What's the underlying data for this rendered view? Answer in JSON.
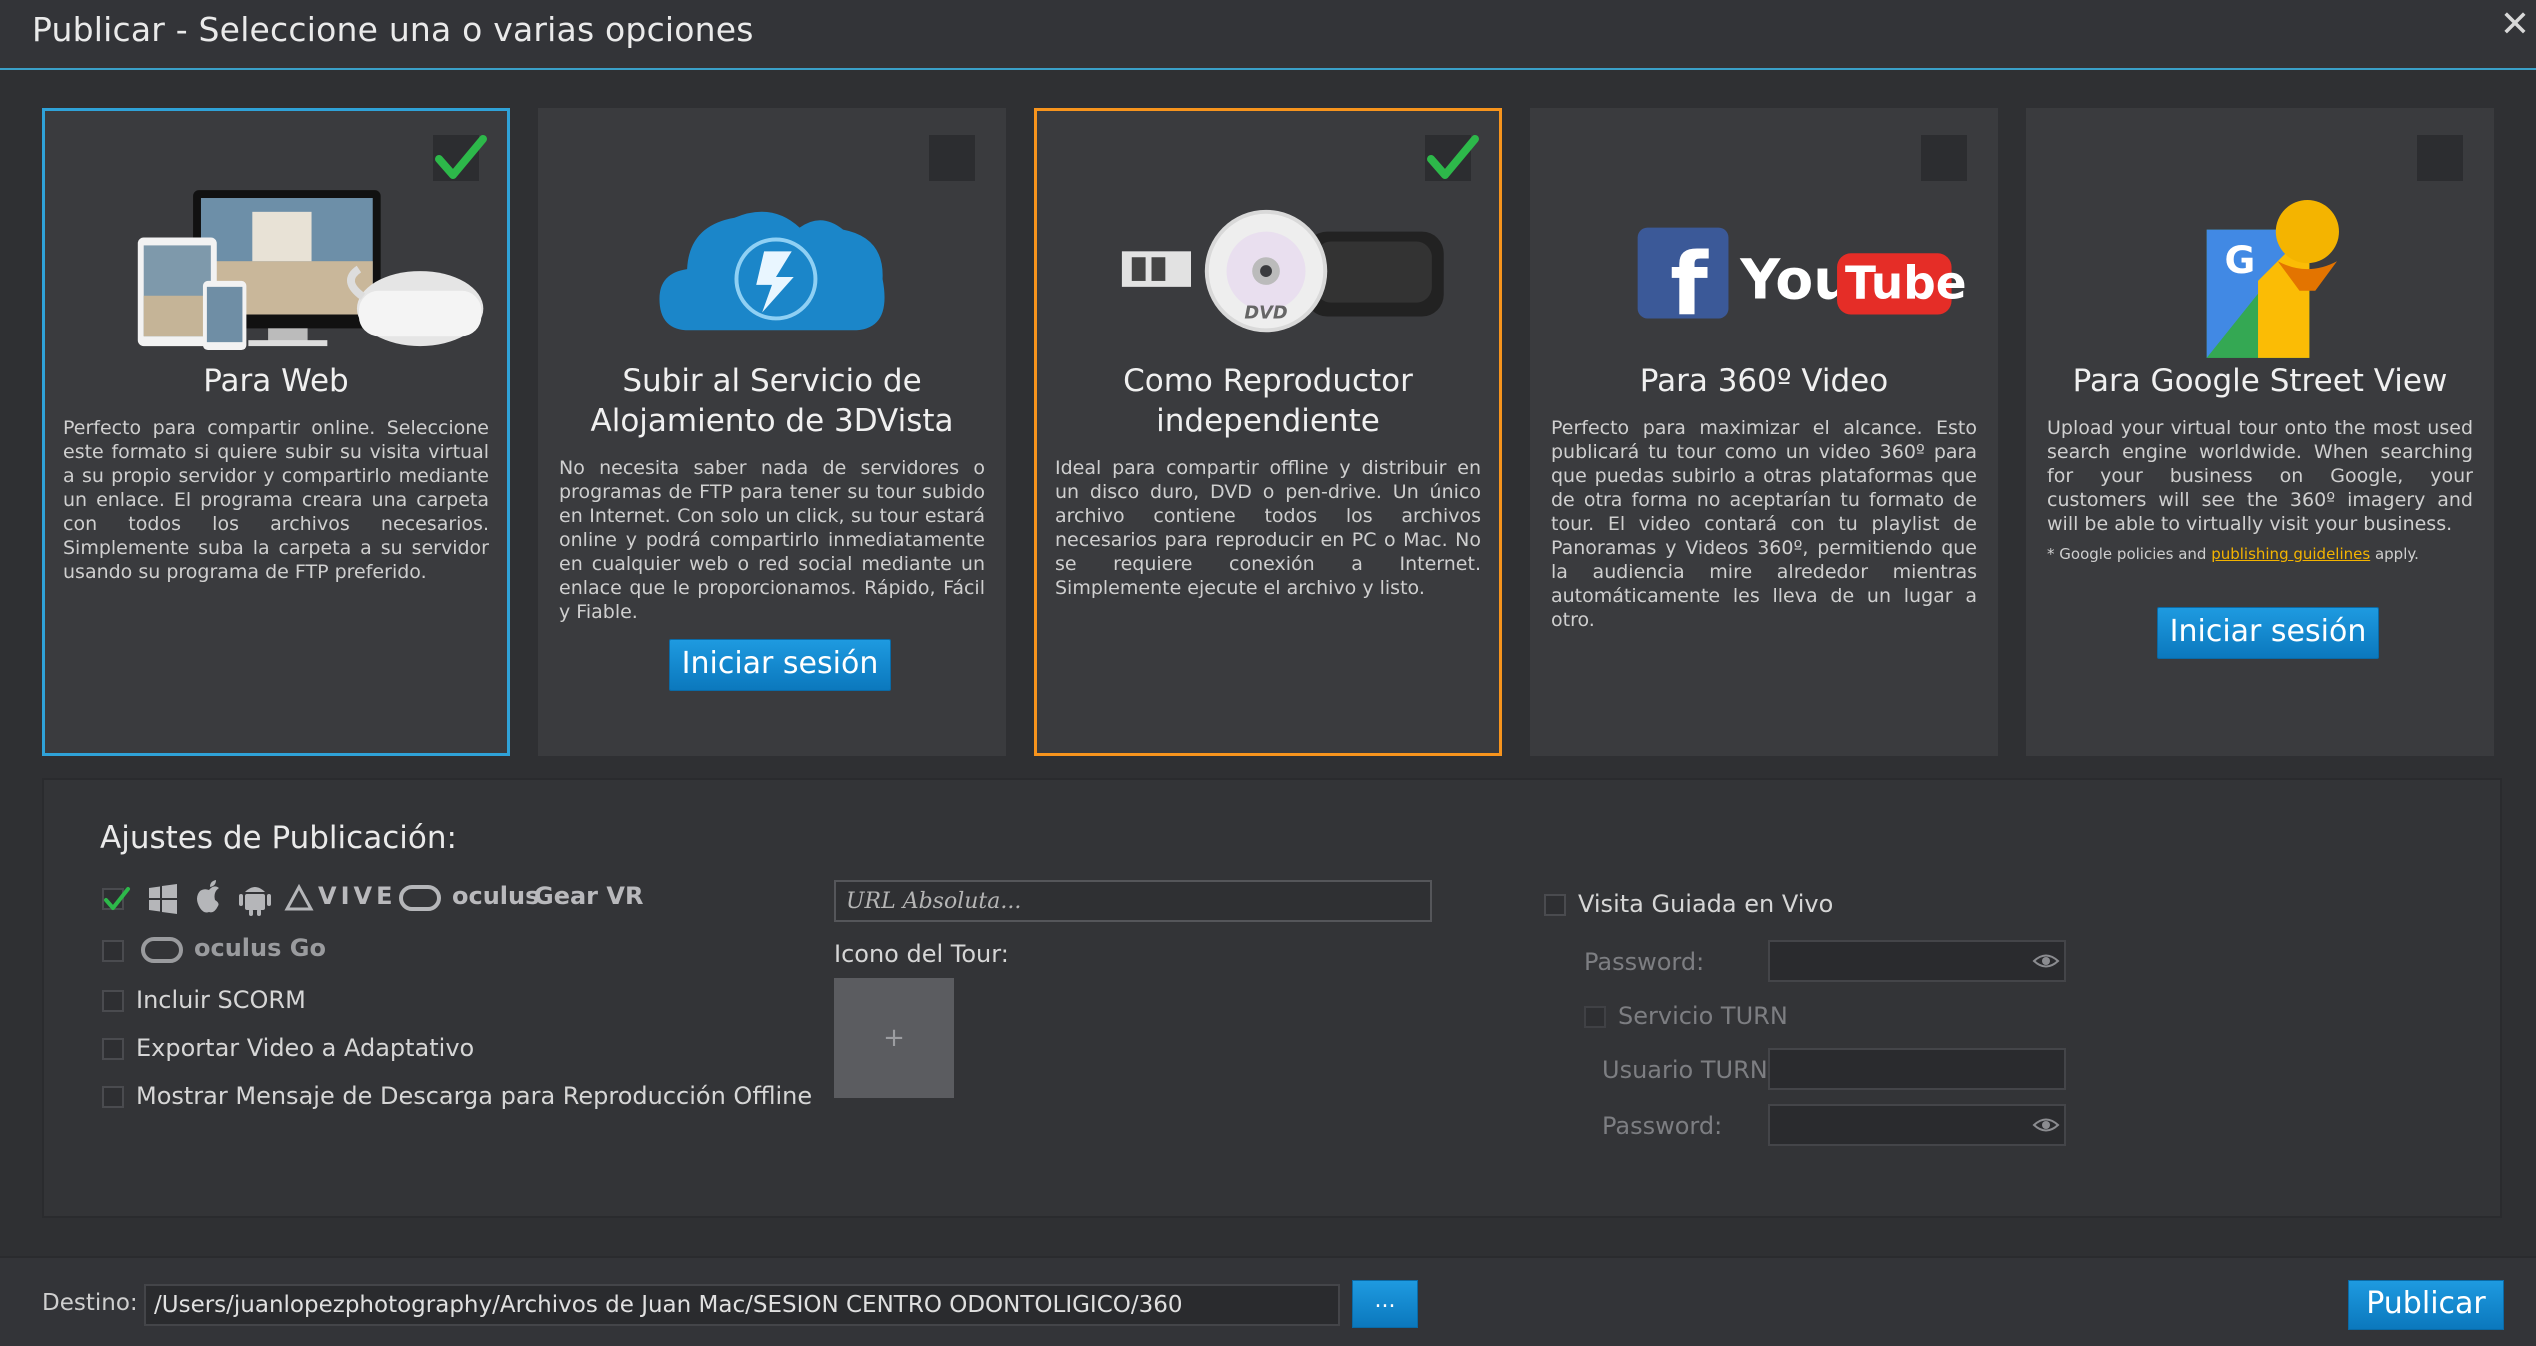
{
  "window": {
    "title": "Publicar - Seleccione una o varias opciones"
  },
  "cards": [
    {
      "title": "Para Web",
      "checked": true,
      "description": "Perfecto para compartir online. Seleccione este formato si quiere subir su visita virtual a su propio servidor y compartirlo mediante un enlace. El programa creara una carpeta con todos los archivos necesarios. Simplemente suba la carpeta a su servidor usando su programa de FTP preferido."
    },
    {
      "title": "Subir al Servicio de Alojamiento de 3DVista",
      "checked": false,
      "description": "No necesita saber nada de servidores o programas de FTP para tener su tour subido en Internet. Con solo un click, su tour estará online y podrá compartirlo inmediatamente en cualquier web o red social mediante un enlace que le proporcionamos. Rápido, Fácil y Fiable.",
      "button": "Iniciar sesión"
    },
    {
      "title": "Como Reproductor independiente",
      "checked": true,
      "description": "Ideal para compartir offline y distribuir en un disco duro, DVD o pen-drive. Un único archivo contiene todos los archivos necesarios para reproducir en PC o Mac. No se requiere conexión a Internet. Simplemente ejecute el archivo y listo.",
      "image_label": "DVD"
    },
    {
      "title": "Para 360º Video",
      "checked": false,
      "description": "Perfecto para maximizar el alcance. Esto publicará tu tour como un video 360º para que puedas subirlo a otras plataformas que de otra forma no aceptarían tu formato de tour. El video contará con tu playlist de Panoramas y Videos 360º, permitiendo que la audiencia mire alrededor mientras automáticamente les lleva de un lugar a otro.",
      "logo_youtube_text": "You",
      "logo_tube_text": "Tube"
    },
    {
      "title": "Para Google Street View",
      "checked": false,
      "description": "Upload your virtual tour onto the most used search engine worldwide. When searching for your business on Google, your customers will see the 360º imagery and will be able to virtually visit your business.",
      "note_prefix": "* Google policies and ",
      "note_link": "publishing guidelines",
      "note_suffix": " apply.",
      "button": "Iniciar sesión"
    }
  ],
  "settings": {
    "title": "Ajustes de Publicación:",
    "platforms_row1": {
      "checked": true,
      "vive": "VIVE",
      "oculus": "oculus",
      "gearvr": "Gear VR"
    },
    "platforms_row2": {
      "checked": false,
      "oculus_go": "oculus Go"
    },
    "include_scorm": "Incluir SCORM",
    "export_adaptive": "Exportar Video a Adaptativo",
    "show_download_msg": "Mostrar Mensaje de Descarga para Reproducción Offline",
    "url_placeholder": "URL Absoluta...",
    "tour_icon_label": "Icono del Tour:",
    "tour_icon_add": "+",
    "live_guided": "Visita Guiada en Vivo",
    "password_label": "Password:",
    "turn_service": "Servicio TURN",
    "turn_user_label": "Usuario TURN:",
    "turn_password_label": "Password:"
  },
  "bottom": {
    "destino_label": "Destino:",
    "destino_path": "/Users/juanlopezphotography/Archivos de Juan Mac/SESION CENTRO ODONTOLIGICO/360",
    "browse": "...",
    "publish": "Publicar"
  },
  "colors": {
    "accent_blue": "#2fa2d8",
    "accent_orange": "#f7941d",
    "check_green": "#2db84a",
    "button_blue": "#1188cf"
  }
}
